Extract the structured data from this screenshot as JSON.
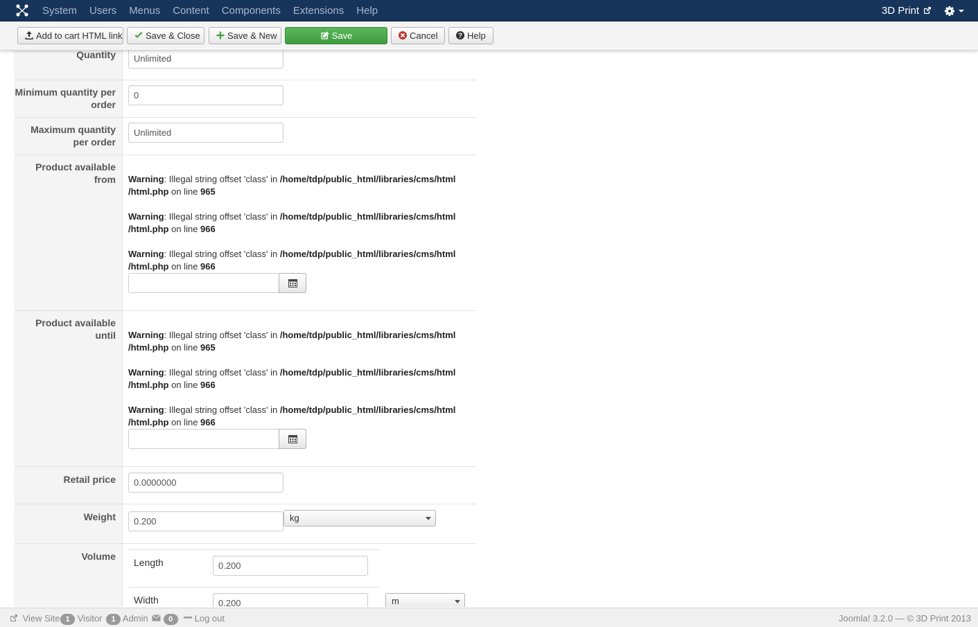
{
  "navbar": {
    "menu": [
      "System",
      "Users",
      "Menus",
      "Content",
      "Components",
      "Extensions",
      "Help"
    ],
    "site_name": "3D Print"
  },
  "toolbar": {
    "add_to_cart": "Add to cart HTML link",
    "save_close": "Save & Close",
    "save_new": "Save & New",
    "save": "Save",
    "cancel": "Cancel",
    "help": "Help"
  },
  "form": {
    "quantity": {
      "label": "Quantity",
      "value": "Unlimited"
    },
    "min_qty": {
      "label_line1": "Minimum quantity per",
      "label_line2": "order",
      "value": "0"
    },
    "max_qty": {
      "label_line1": "Maximum quantity",
      "label_line2": "per order",
      "value": "Unlimited"
    },
    "available_from": {
      "label_line1": "Product available",
      "label_line2": "from"
    },
    "available_until": {
      "label_line1": "Product available",
      "label_line2": "until"
    },
    "warning": {
      "word": "Warning",
      "message": ": Illegal string offset 'class' in ",
      "path_line1": "/home/tdp/public_html/libraries/cms/html",
      "path_line2": "/html.php",
      "on_line": " on line ",
      "line_a": "965",
      "line_b": "966"
    },
    "retail_price": {
      "label": "Retail price",
      "value": "0.0000000"
    },
    "weight": {
      "label": "Weight",
      "value": "0.200",
      "unit": "kg"
    },
    "volume": {
      "label": "Volume",
      "length_label": "Length",
      "length_value": "0.200",
      "width_label": "Width",
      "width_value": "0.200",
      "unit": "m"
    }
  },
  "footer": {
    "view_site": "View Site",
    "visitor_count": "1",
    "visitor_label": "Visitor",
    "admin_count": "1",
    "admin_label": "Admin",
    "messages_count": "0",
    "logout": "Log out",
    "copyright": "Joomla! 3.2.0 — © 3D Print 2013"
  },
  "colors": {
    "navbar_bg": "#17345a",
    "save_green": "#46a546",
    "cancel_red": "#bd362f"
  }
}
